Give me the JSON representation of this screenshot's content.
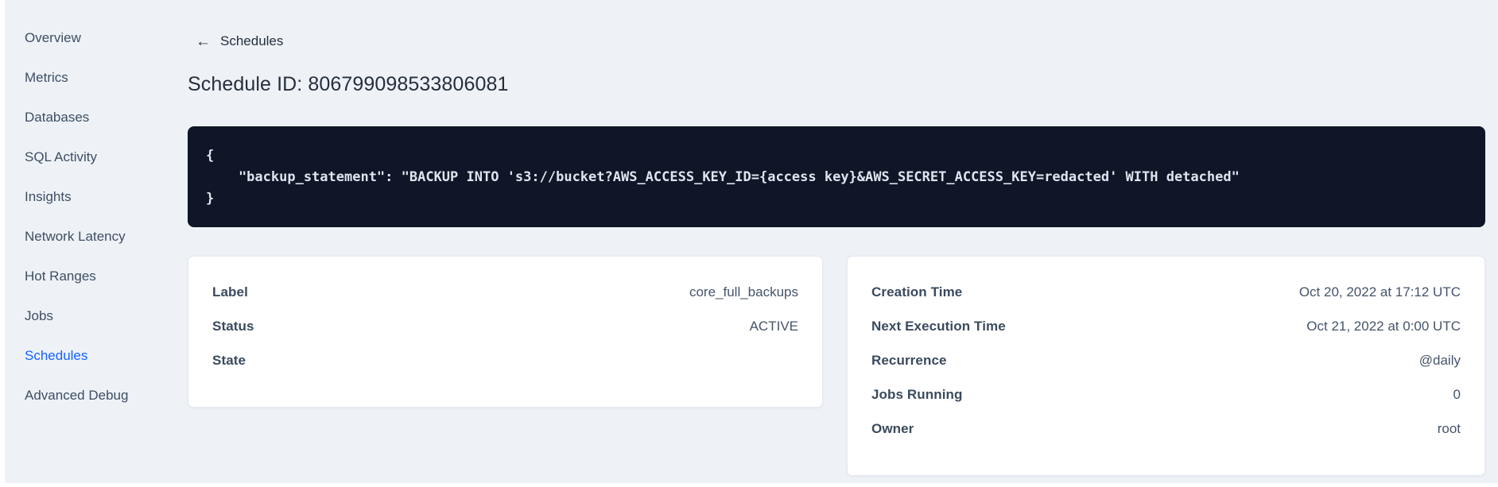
{
  "sidebar": {
    "items": [
      {
        "label": "Overview",
        "active": false
      },
      {
        "label": "Metrics",
        "active": false
      },
      {
        "label": "Databases",
        "active": false
      },
      {
        "label": "SQL Activity",
        "active": false
      },
      {
        "label": "Insights",
        "active": false
      },
      {
        "label": "Network Latency",
        "active": false
      },
      {
        "label": "Hot Ranges",
        "active": false
      },
      {
        "label": "Jobs",
        "active": false
      },
      {
        "label": "Schedules",
        "active": true
      },
      {
        "label": "Advanced Debug",
        "active": false
      }
    ]
  },
  "header": {
    "back_icon": "←",
    "back_label": "Schedules",
    "title": "Schedule ID: 806799098533806081"
  },
  "code_block": {
    "content": "{\n    \"backup_statement\": \"BACKUP INTO 's3://bucket?AWS_ACCESS_KEY_ID={access key}&AWS_SECRET_ACCESS_KEY=redacted' WITH detached\"\n}"
  },
  "details_left": {
    "rows": [
      {
        "label": "Label",
        "value": "core_full_backups"
      },
      {
        "label": "Status",
        "value": "ACTIVE"
      },
      {
        "label": "State",
        "value": ""
      }
    ]
  },
  "details_right": {
    "rows": [
      {
        "label": "Creation Time",
        "value": "Oct 20, 2022 at 17:12 UTC"
      },
      {
        "label": "Next Execution Time",
        "value": "Oct 21, 2022 at 0:00 UTC"
      },
      {
        "label": "Recurrence",
        "value": "@daily"
      },
      {
        "label": "Jobs Running",
        "value": "0"
      },
      {
        "label": "Owner",
        "value": "root"
      }
    ]
  },
  "colors": {
    "page_background": "#eef2f7",
    "accent_blue": "#1563ff",
    "code_background": "#0e1628",
    "code_text": "#dfe5ee",
    "sidebar_text": "#3e4e63",
    "card_background": "#ffffff"
  }
}
